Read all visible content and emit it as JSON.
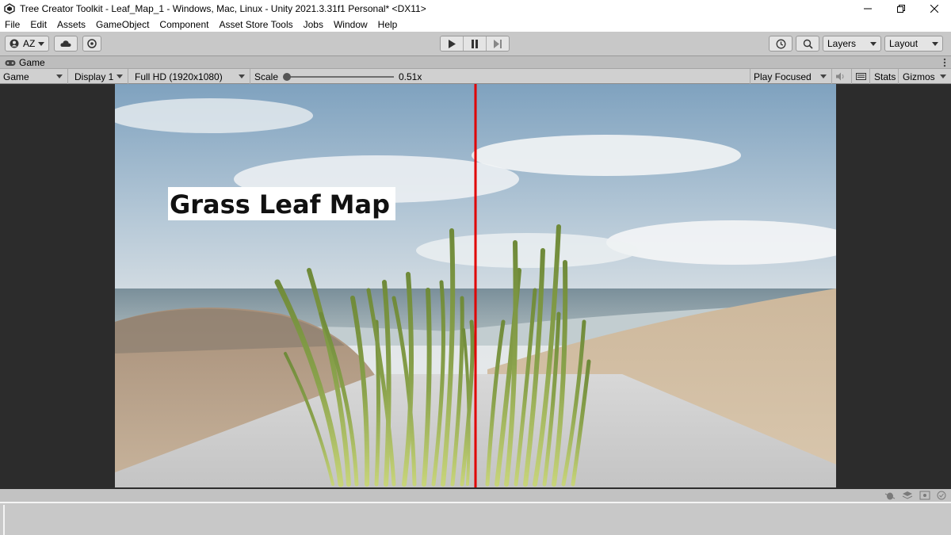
{
  "window": {
    "title": "Tree Creator Toolkit - Leaf_Map_1 - Windows, Mac, Linux - Unity 2021.3.31f1 Personal* <DX11>"
  },
  "menu": [
    "File",
    "Edit",
    "Assets",
    "GameObject",
    "Component",
    "Asset Store Tools",
    "Jobs",
    "Window",
    "Help"
  ],
  "toolbar": {
    "account_label": "AZ",
    "layers_label": "Layers",
    "layout_label": "Layout"
  },
  "tab": {
    "label": "Game"
  },
  "game_toolbar": {
    "view_mode": "Game",
    "display": "Display 1",
    "resolution": "Full HD (1920x1080)",
    "scale_label": "Scale",
    "scale_value": "0.51x",
    "scale_fraction": 0.0,
    "play_mode": "Play Focused",
    "stats": "Stats",
    "gizmos": "Gizmos"
  },
  "scene": {
    "label": "Grass Leaf Map",
    "divider_color": "#e00000"
  }
}
